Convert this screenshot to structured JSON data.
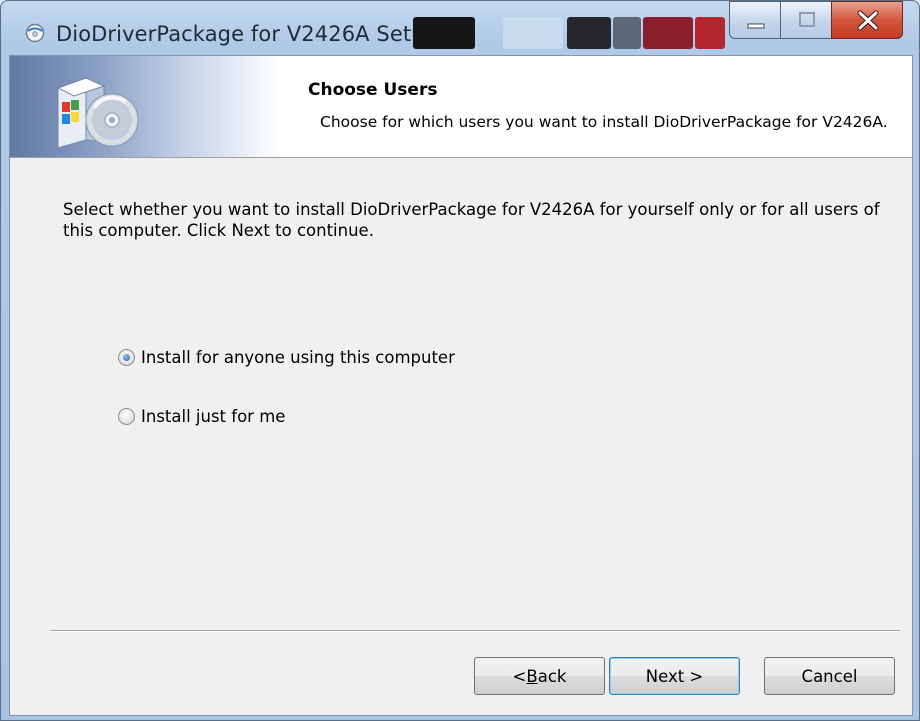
{
  "window": {
    "title": "DioDriverPackage for V2426A Setup"
  },
  "header": {
    "title": "Choose Users",
    "subtitle": "Choose for which users you want to install DioDriverPackage for V2426A."
  },
  "body": {
    "intro": "Select whether you want to install DioDriverPackage for V2426A for yourself only or for all users of this computer. Click Next to continue.",
    "options": [
      {
        "label": "Install for anyone using this computer",
        "checked": true
      },
      {
        "label": "Install just for me",
        "checked": false
      }
    ]
  },
  "buttons": {
    "back_prefix": "< ",
    "back_key": "B",
    "back_rest": "ack",
    "next": "Next >",
    "cancel": "Cancel"
  },
  "colors": {
    "titlebar": "#b0c9e6",
    "close_button": "#d4553c",
    "dialog_bg": "#f0f0f0",
    "default_button_border": "#3c7fb1"
  }
}
